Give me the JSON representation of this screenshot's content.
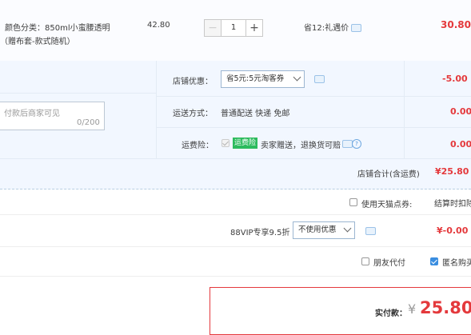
{
  "item": {
    "sku_line1": "颜色分类：850ml小蛮腰透明",
    "sku_line2": "（赠布套-款式随机）",
    "price": "42.80",
    "quantity": "1",
    "minus": "−",
    "plus": "+",
    "promo": "省12:礼遇价",
    "subtotal": "30.80"
  },
  "shop": {
    "discount_label": "店铺优惠：",
    "discount_select": "省5元:5元淘客券",
    "discount_amount": "-5.00",
    "message_placeholder": "付款后商家可见",
    "message_count": "0/200",
    "shipping_label": "运送方式：",
    "shipping_value": "普通配送 快递 免邮",
    "shipping_amount": "0.00",
    "insurance_label": "运费险：",
    "insurance_badge": "运费险",
    "insurance_text": "卖家赠送，退换货可赔",
    "insurance_amount": "0.00",
    "help_glyph": "?",
    "total_label": "店铺合计(含运费)",
    "total_value": "¥25.80"
  },
  "points": {
    "label": "使用天猫点券:",
    "settle": "结算时扣除"
  },
  "vip": {
    "label": "88VIP专享9.5折",
    "select": "不使用优惠",
    "amount": "¥-0.00"
  },
  "options": {
    "friend_pay": "朋友代付",
    "anonymous": "匿名购买"
  },
  "pay": {
    "label": "实付款：",
    "currency": "¥",
    "amount": "25.80"
  },
  "colors": {
    "accent_red": "#e4393c",
    "link_blue": "#3a8de0",
    "badge_green": "#2dbb5d"
  },
  "icons": [
    "chat-bubble-icon",
    "question-icon",
    "chevron-down-icon",
    "checkbox-icon"
  ]
}
